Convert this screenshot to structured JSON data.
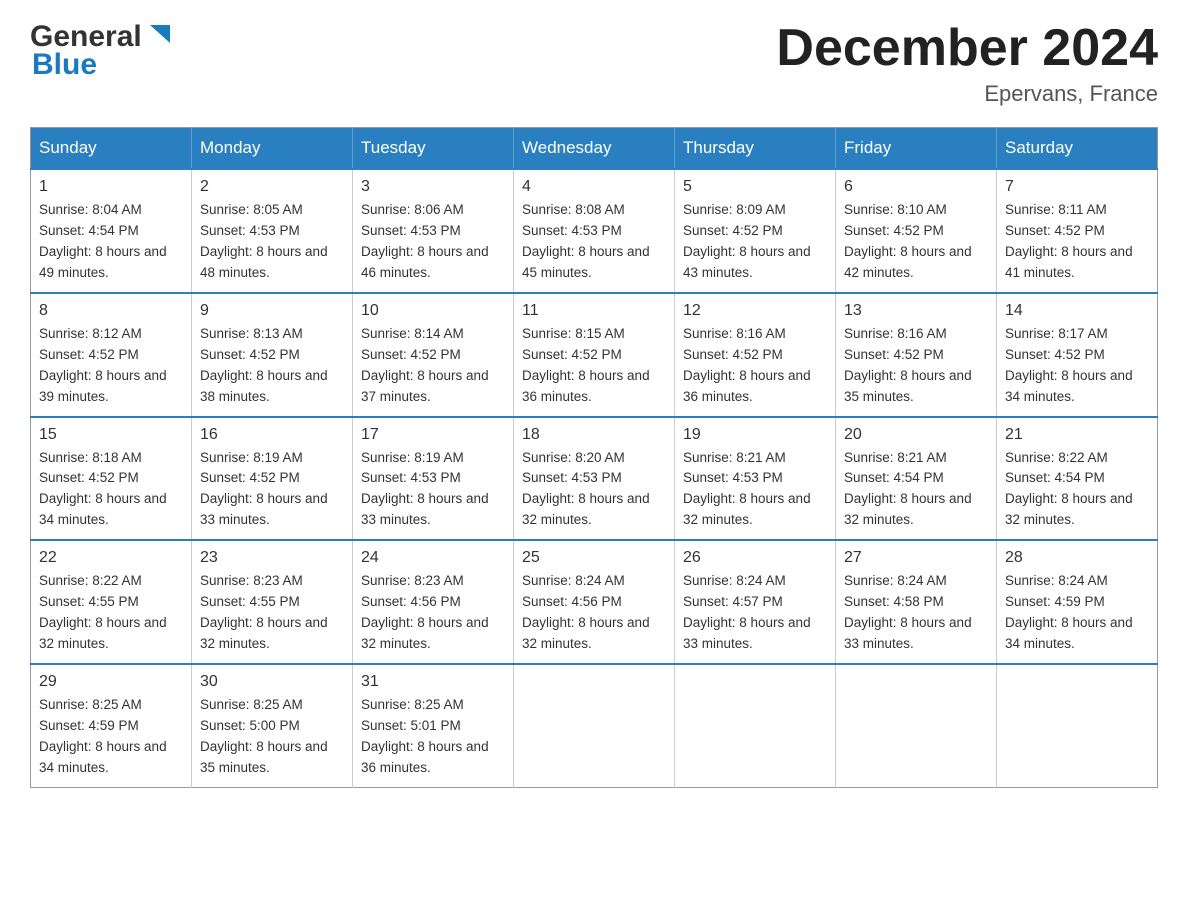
{
  "header": {
    "logo_text_general": "General",
    "logo_text_blue": "Blue",
    "month_title": "December 2024",
    "location": "Epervans, France"
  },
  "days_of_week": [
    "Sunday",
    "Monday",
    "Tuesday",
    "Wednesday",
    "Thursday",
    "Friday",
    "Saturday"
  ],
  "weeks": [
    [
      {
        "day": 1,
        "sunrise": "8:04 AM",
        "sunset": "4:54 PM",
        "daylight": "8 hours and 49 minutes."
      },
      {
        "day": 2,
        "sunrise": "8:05 AM",
        "sunset": "4:53 PM",
        "daylight": "8 hours and 48 minutes."
      },
      {
        "day": 3,
        "sunrise": "8:06 AM",
        "sunset": "4:53 PM",
        "daylight": "8 hours and 46 minutes."
      },
      {
        "day": 4,
        "sunrise": "8:08 AM",
        "sunset": "4:53 PM",
        "daylight": "8 hours and 45 minutes."
      },
      {
        "day": 5,
        "sunrise": "8:09 AM",
        "sunset": "4:52 PM",
        "daylight": "8 hours and 43 minutes."
      },
      {
        "day": 6,
        "sunrise": "8:10 AM",
        "sunset": "4:52 PM",
        "daylight": "8 hours and 42 minutes."
      },
      {
        "day": 7,
        "sunrise": "8:11 AM",
        "sunset": "4:52 PM",
        "daylight": "8 hours and 41 minutes."
      }
    ],
    [
      {
        "day": 8,
        "sunrise": "8:12 AM",
        "sunset": "4:52 PM",
        "daylight": "8 hours and 39 minutes."
      },
      {
        "day": 9,
        "sunrise": "8:13 AM",
        "sunset": "4:52 PM",
        "daylight": "8 hours and 38 minutes."
      },
      {
        "day": 10,
        "sunrise": "8:14 AM",
        "sunset": "4:52 PM",
        "daylight": "8 hours and 37 minutes."
      },
      {
        "day": 11,
        "sunrise": "8:15 AM",
        "sunset": "4:52 PM",
        "daylight": "8 hours and 36 minutes."
      },
      {
        "day": 12,
        "sunrise": "8:16 AM",
        "sunset": "4:52 PM",
        "daylight": "8 hours and 36 minutes."
      },
      {
        "day": 13,
        "sunrise": "8:16 AM",
        "sunset": "4:52 PM",
        "daylight": "8 hours and 35 minutes."
      },
      {
        "day": 14,
        "sunrise": "8:17 AM",
        "sunset": "4:52 PM",
        "daylight": "8 hours and 34 minutes."
      }
    ],
    [
      {
        "day": 15,
        "sunrise": "8:18 AM",
        "sunset": "4:52 PM",
        "daylight": "8 hours and 34 minutes."
      },
      {
        "day": 16,
        "sunrise": "8:19 AM",
        "sunset": "4:52 PM",
        "daylight": "8 hours and 33 minutes."
      },
      {
        "day": 17,
        "sunrise": "8:19 AM",
        "sunset": "4:53 PM",
        "daylight": "8 hours and 33 minutes."
      },
      {
        "day": 18,
        "sunrise": "8:20 AM",
        "sunset": "4:53 PM",
        "daylight": "8 hours and 32 minutes."
      },
      {
        "day": 19,
        "sunrise": "8:21 AM",
        "sunset": "4:53 PM",
        "daylight": "8 hours and 32 minutes."
      },
      {
        "day": 20,
        "sunrise": "8:21 AM",
        "sunset": "4:54 PM",
        "daylight": "8 hours and 32 minutes."
      },
      {
        "day": 21,
        "sunrise": "8:22 AM",
        "sunset": "4:54 PM",
        "daylight": "8 hours and 32 minutes."
      }
    ],
    [
      {
        "day": 22,
        "sunrise": "8:22 AM",
        "sunset": "4:55 PM",
        "daylight": "8 hours and 32 minutes."
      },
      {
        "day": 23,
        "sunrise": "8:23 AM",
        "sunset": "4:55 PM",
        "daylight": "8 hours and 32 minutes."
      },
      {
        "day": 24,
        "sunrise": "8:23 AM",
        "sunset": "4:56 PM",
        "daylight": "8 hours and 32 minutes."
      },
      {
        "day": 25,
        "sunrise": "8:24 AM",
        "sunset": "4:56 PM",
        "daylight": "8 hours and 32 minutes."
      },
      {
        "day": 26,
        "sunrise": "8:24 AM",
        "sunset": "4:57 PM",
        "daylight": "8 hours and 33 minutes."
      },
      {
        "day": 27,
        "sunrise": "8:24 AM",
        "sunset": "4:58 PM",
        "daylight": "8 hours and 33 minutes."
      },
      {
        "day": 28,
        "sunrise": "8:24 AM",
        "sunset": "4:59 PM",
        "daylight": "8 hours and 34 minutes."
      }
    ],
    [
      {
        "day": 29,
        "sunrise": "8:25 AM",
        "sunset": "4:59 PM",
        "daylight": "8 hours and 34 minutes."
      },
      {
        "day": 30,
        "sunrise": "8:25 AM",
        "sunset": "5:00 PM",
        "daylight": "8 hours and 35 minutes."
      },
      {
        "day": 31,
        "sunrise": "8:25 AM",
        "sunset": "5:01 PM",
        "daylight": "8 hours and 36 minutes."
      },
      null,
      null,
      null,
      null
    ]
  ]
}
